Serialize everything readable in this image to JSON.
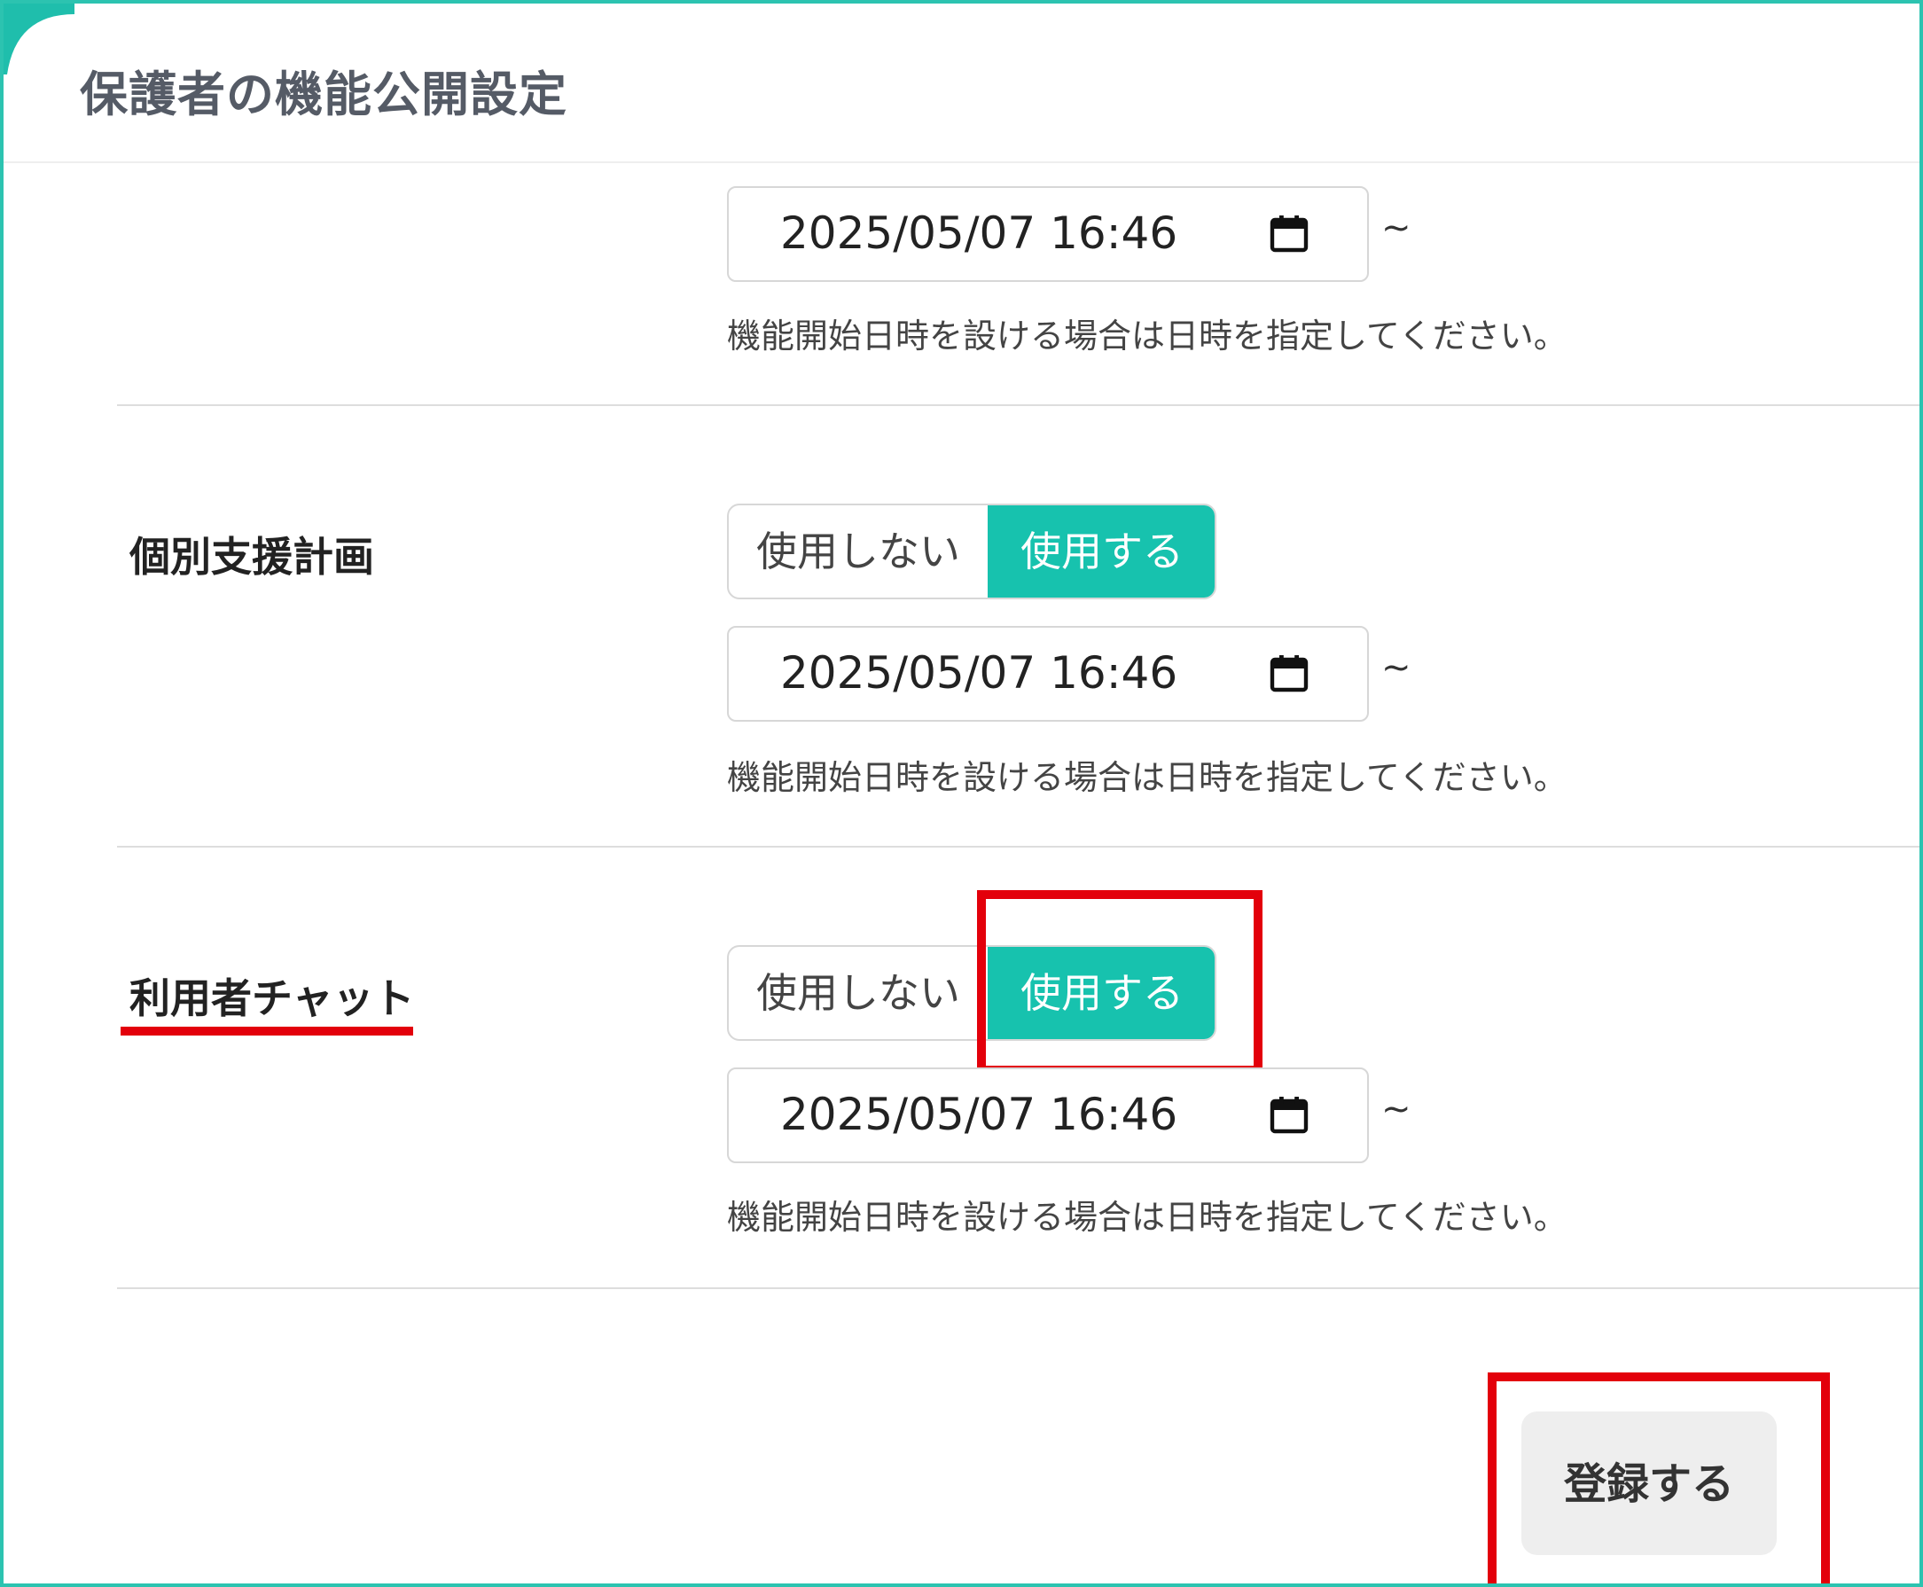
{
  "header": {
    "title": "保護者の機能公開設定"
  },
  "rows": [
    {
      "label": "",
      "datetime_value": "2025/05/07 16:46",
      "tilde": "~",
      "hint": "機能開始日時を設ける場合は日時を指定してください。"
    },
    {
      "label": "個別支援計画",
      "toggle": {
        "off_label": "使用しない",
        "on_label": "使用する",
        "selected": "使用する"
      },
      "datetime_value": "2025/05/07 16:46",
      "tilde": "~",
      "hint": "機能開始日時を設ける場合は日時を指定してください。"
    },
    {
      "label": "利用者チャット",
      "toggle": {
        "off_label": "使用しない",
        "on_label": "使用する",
        "selected": "使用する"
      },
      "datetime_value": "2025/05/07 16:46",
      "tilde": "~",
      "hint": "機能開始日時を設ける場合は日時を指定してください。"
    }
  ],
  "submit": {
    "label": "登録する"
  },
  "icons": {
    "datetime_picker": "calendar-icon"
  },
  "colors": {
    "accent": "#17c2ae",
    "frame_border": "#2cc3b0",
    "annotation_red": "#e3000b",
    "button_bg": "#eeeeee"
  }
}
